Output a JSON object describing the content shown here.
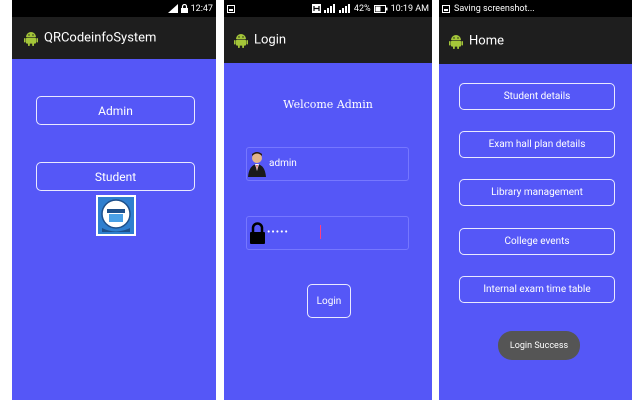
{
  "screen1": {
    "status": {
      "time": "12:47"
    },
    "app_title": "QRCodeinfoSystem",
    "buttons": {
      "admin": "Admin",
      "student": "Student"
    }
  },
  "screen2": {
    "status": {
      "battery": "42%",
      "time": "10:19 AM"
    },
    "title": "Login",
    "welcome": "Welcome Admin",
    "username": {
      "value": "admin"
    },
    "password": {
      "masked": "•••••"
    },
    "login_button": "Login"
  },
  "screen3": {
    "status": {
      "notification": "Saving screenshot..."
    },
    "title": "Home",
    "menu": [
      {
        "label": "Student details"
      },
      {
        "label": "Exam hall plan details"
      },
      {
        "label": "Library management"
      },
      {
        "label": "College events"
      },
      {
        "label": "Internal exam time table"
      }
    ],
    "toast": "Login Success"
  },
  "colors": {
    "background": "#5557f7",
    "actionbar": "#1e1e1e",
    "statusbar": "#000000",
    "android_green": "#a4c639"
  }
}
